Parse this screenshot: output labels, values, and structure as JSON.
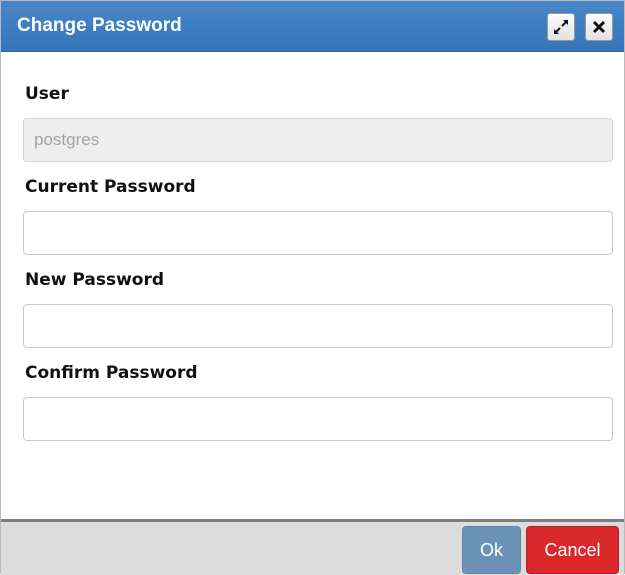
{
  "dialog": {
    "title": "Change Password",
    "maximize_icon": "expand-arrows-icon",
    "close_icon": "close-x-icon"
  },
  "form": {
    "user_label": "User",
    "user_value": "postgres",
    "current_password_label": "Current Password",
    "current_password_value": "",
    "new_password_label": "New Password",
    "new_password_value": "",
    "confirm_password_label": "Confirm Password",
    "confirm_password_value": ""
  },
  "footer": {
    "ok_label": "Ok",
    "cancel_label": "Cancel"
  },
  "colors": {
    "titlebar": "#3f7ec0",
    "ok_button": "#6c93b7",
    "cancel_button": "#d9292d",
    "footer": "#dcdcdc"
  }
}
